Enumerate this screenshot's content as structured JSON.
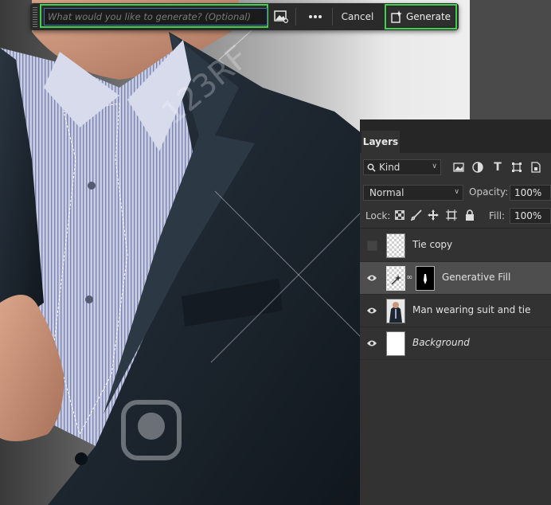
{
  "taskbar": {
    "prompt_placeholder": "What would you like to generate? (Optional)",
    "prompt_value": "",
    "image_button_icon": "image-reference-icon",
    "more_icon": "more-dots-icon",
    "cancel_label": "Cancel",
    "generate_label": "Generate",
    "generate_icon": "generate-sparkle-icon",
    "highlight_color": "#3fd24a"
  },
  "watermark": {
    "text": "123RF"
  },
  "layers_panel": {
    "tab_label": "Layers",
    "filter": {
      "kind_label": "Kind",
      "icons": [
        "pixel-filter-icon",
        "adjustment-filter-icon",
        "type-filter-icon",
        "shape-filter-icon",
        "smart-object-filter-icon"
      ]
    },
    "blend_mode": "Normal",
    "opacity_label": "Opacity:",
    "opacity_value": "100%",
    "lock_label": "Lock:",
    "fill_label": "Fill:",
    "fill_value": "100%",
    "layers": [
      {
        "name": "Tie copy",
        "visible": false,
        "selected": false,
        "thumb": "transparent"
      },
      {
        "name": "Generative Fill",
        "visible": true,
        "selected": true,
        "thumb": "generative",
        "has_mask": true
      },
      {
        "name": "Man wearing suit and tie",
        "visible": true,
        "selected": false,
        "thumb": "photo"
      },
      {
        "name": "Background",
        "visible": true,
        "selected": false,
        "thumb": "white",
        "italic": true
      }
    ]
  }
}
